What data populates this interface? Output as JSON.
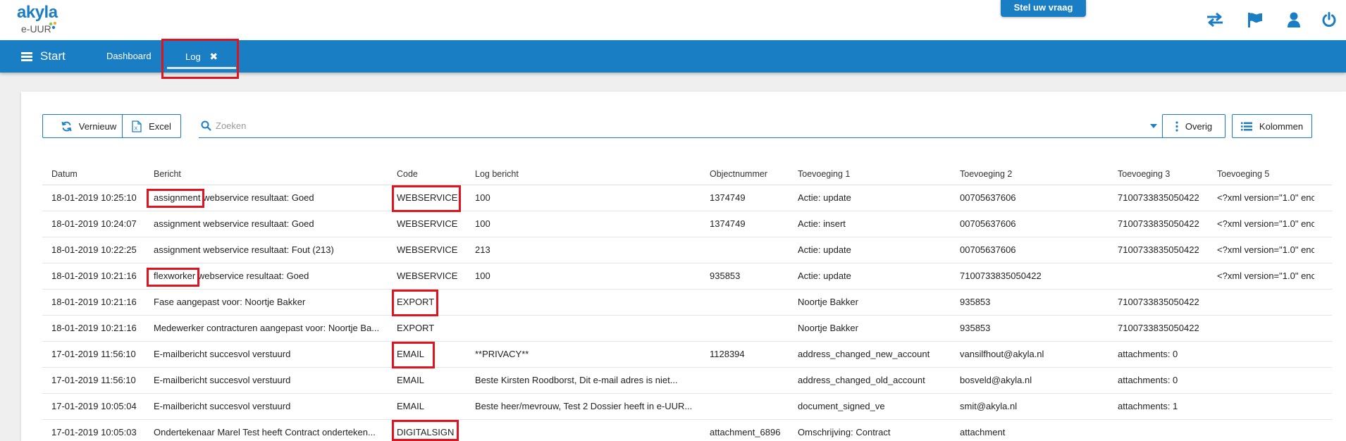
{
  "app": {
    "logo_text": "akyla",
    "logo_subtext": "e-UUR",
    "help_button": "Stel uw vraag"
  },
  "header_icons": [
    "swap-icon",
    "flag-icon",
    "user-icon",
    "power-icon"
  ],
  "nav": {
    "start_label": "Start",
    "tabs": [
      {
        "label": "Dashboard"
      },
      {
        "label": "Log",
        "active": true,
        "closable": true
      }
    ]
  },
  "toolbar": {
    "refresh_label": "Vernieuw",
    "excel_label": "Excel",
    "search_placeholder": "Zoeken",
    "more_label": "Overig",
    "columns_label": "Kolommen"
  },
  "table": {
    "columns": [
      "Datum",
      "Bericht",
      "Code",
      "Log bericht",
      "Objectnummer",
      "Toevoeging 1",
      "Toevoeging 2",
      "Toevoeging 3",
      "Toevoeging 5"
    ],
    "rows": [
      [
        "18-01-2019 10:25:10",
        "assignment webservice resultaat: Goed",
        "WEBSERVICE",
        "100",
        "1374749",
        "Actie: update",
        "00705637606",
        "7100733835050422",
        "<?xml version=\"1.0\" enc"
      ],
      [
        "18-01-2019 10:24:07",
        "assignment webservice resultaat: Goed",
        "WEBSERVICE",
        "100",
        "1374749",
        "Actie: insert",
        "00705637606",
        "7100733835050422",
        "<?xml version=\"1.0\" enc"
      ],
      [
        "18-01-2019 10:22:25",
        "assignment webservice resultaat: Fout (213)",
        "WEBSERVICE",
        "213",
        "",
        "Actie: update",
        "00705637606",
        "7100733835050422",
        "<?xml version=\"1.0\" enc"
      ],
      [
        "18-01-2019 10:21:16",
        "flexworker webservice resultaat: Goed",
        "WEBSERVICE",
        "100",
        "935853",
        "Actie: update",
        "7100733835050422",
        "",
        "<?xml version=\"1.0\" enc"
      ],
      [
        "18-01-2019 10:21:16",
        "Fase aangepast voor: Noortje Bakker",
        "EXPORT",
        "",
        "",
        "Noortje Bakker",
        "935853",
        "7100733835050422",
        ""
      ],
      [
        "18-01-2019 10:21:16",
        "Medewerker contracturen aangepast voor: Noortje Ba...",
        "EXPORT",
        "",
        "",
        "Noortje Bakker",
        "935853",
        "7100733835050422",
        ""
      ],
      [
        "17-01-2019 11:56:10",
        "E-mailbericht succesvol verstuurd",
        "EMAIL",
        "**PRIVACY**",
        "1128394",
        "address_changed_new_account",
        "vansilfhout@akyla.nl",
        "attachments: 0",
        ""
      ],
      [
        "17-01-2019 11:56:10",
        "E-mailbericht succesvol verstuurd",
        "EMAIL",
        "Beste Kirsten Roodborst, Dit e-mail adres is niet...",
        "",
        "address_changed_old_account",
        "bosveld@akyla.nl",
        "attachments: 0",
        ""
      ],
      [
        "17-01-2019 10:05:04",
        "E-mailbericht succesvol verstuurd",
        "EMAIL",
        "Beste heer/mevrouw, Test 2 Dossier heeft in e-UUR...",
        "",
        "document_signed_ve",
        "smit@akyla.nl",
        "attachments: 1",
        ""
      ],
      [
        "17-01-2019 10:05:03",
        "Ondertekenaar Marel Test heeft Contract onderteken...",
        "DIGITALSIGN",
        "",
        "attachment_6896",
        "Omschrijving: Contract",
        "attachment",
        "",
        ""
      ]
    ]
  },
  "colors": {
    "primary": "#1a7ec4",
    "highlight_box": "#e0141e"
  }
}
